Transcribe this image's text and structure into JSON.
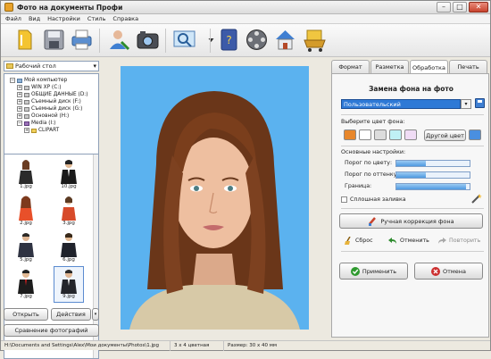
{
  "window": {
    "title": "Фото на документы Профи"
  },
  "menu": [
    "Файл",
    "Вид",
    "Настройки",
    "Стиль",
    "Справка"
  ],
  "toolbar": {
    "icons": [
      "open-icon",
      "save-icon",
      "print-icon",
      "user-icon",
      "camera-icon",
      "scan-icon",
      "help-book-icon",
      "film-icon",
      "home-icon",
      "shopping-cart-icon"
    ]
  },
  "left": {
    "drive_select": "Рабочий стол",
    "tree": [
      {
        "label": "Мой компьютер",
        "icon": "pc",
        "expander": "−"
      },
      {
        "label": "WIN XP (C:)",
        "icon": "drv",
        "expander": "+"
      },
      {
        "label": "ОБЩИЕ ДАННЫЕ (D:)",
        "icon": "drv",
        "expander": "+"
      },
      {
        "label": "Съемный диск (F:)",
        "icon": "drv",
        "expander": "+"
      },
      {
        "label": "Съемный диск (G:)",
        "icon": "drv",
        "expander": "+"
      },
      {
        "label": "Основной (H:)",
        "icon": "drv",
        "expander": "+"
      },
      {
        "label": "Media (I:)",
        "icon": "med",
        "expander": "−"
      },
      {
        "label": "CLIPART",
        "icon": "fld",
        "expander": "+"
      }
    ],
    "thumbs": [
      "1.jpg",
      "10.jpg",
      "2.jpg",
      "3.jpg",
      "5.jpg",
      "6.jpg",
      "7.jpg",
      "8.jpg",
      "9.jpg"
    ],
    "open_button": "Открыть",
    "actions_button": "Действия",
    "compare_button": "Сравнение фотографий"
  },
  "tabs": [
    "Формат",
    "Разметка",
    "Обработка",
    "Печать"
  ],
  "active_tab": "Обработка",
  "panel": {
    "title": "Замена фона на фото",
    "preset": "Пользовательский",
    "color_label": "Выберите цвет фона:",
    "swatches": [
      "#e8872b",
      "#ffffff",
      "#dcdcdc",
      "#bff0f5",
      "#f0dcf5",
      "#4a8fe0"
    ],
    "other_color": "Другой цвет",
    "main_settings": "Основные настройки:",
    "threshold_color": "Порог по цвету:",
    "threshold_shade": "Порог по оттенку:",
    "border": "Граница:",
    "threshold_color_value": 0.4,
    "threshold_shade_value": 0.4,
    "border_value": 0.95,
    "solid_fill": "Сплошная заливка",
    "manual_correction": "Ручная коррекция фона",
    "reset": "Сброс",
    "undo": "Отменить",
    "redo": "Повторить",
    "apply": "Применить",
    "cancel": "Отмена"
  },
  "status": {
    "path": "H:\\Documents and Settings\\Alex\\Мои документы\\Photos\\1.jpg",
    "format": "3 x 4 цветная",
    "size": "Размер: 30 x 40 мм"
  }
}
